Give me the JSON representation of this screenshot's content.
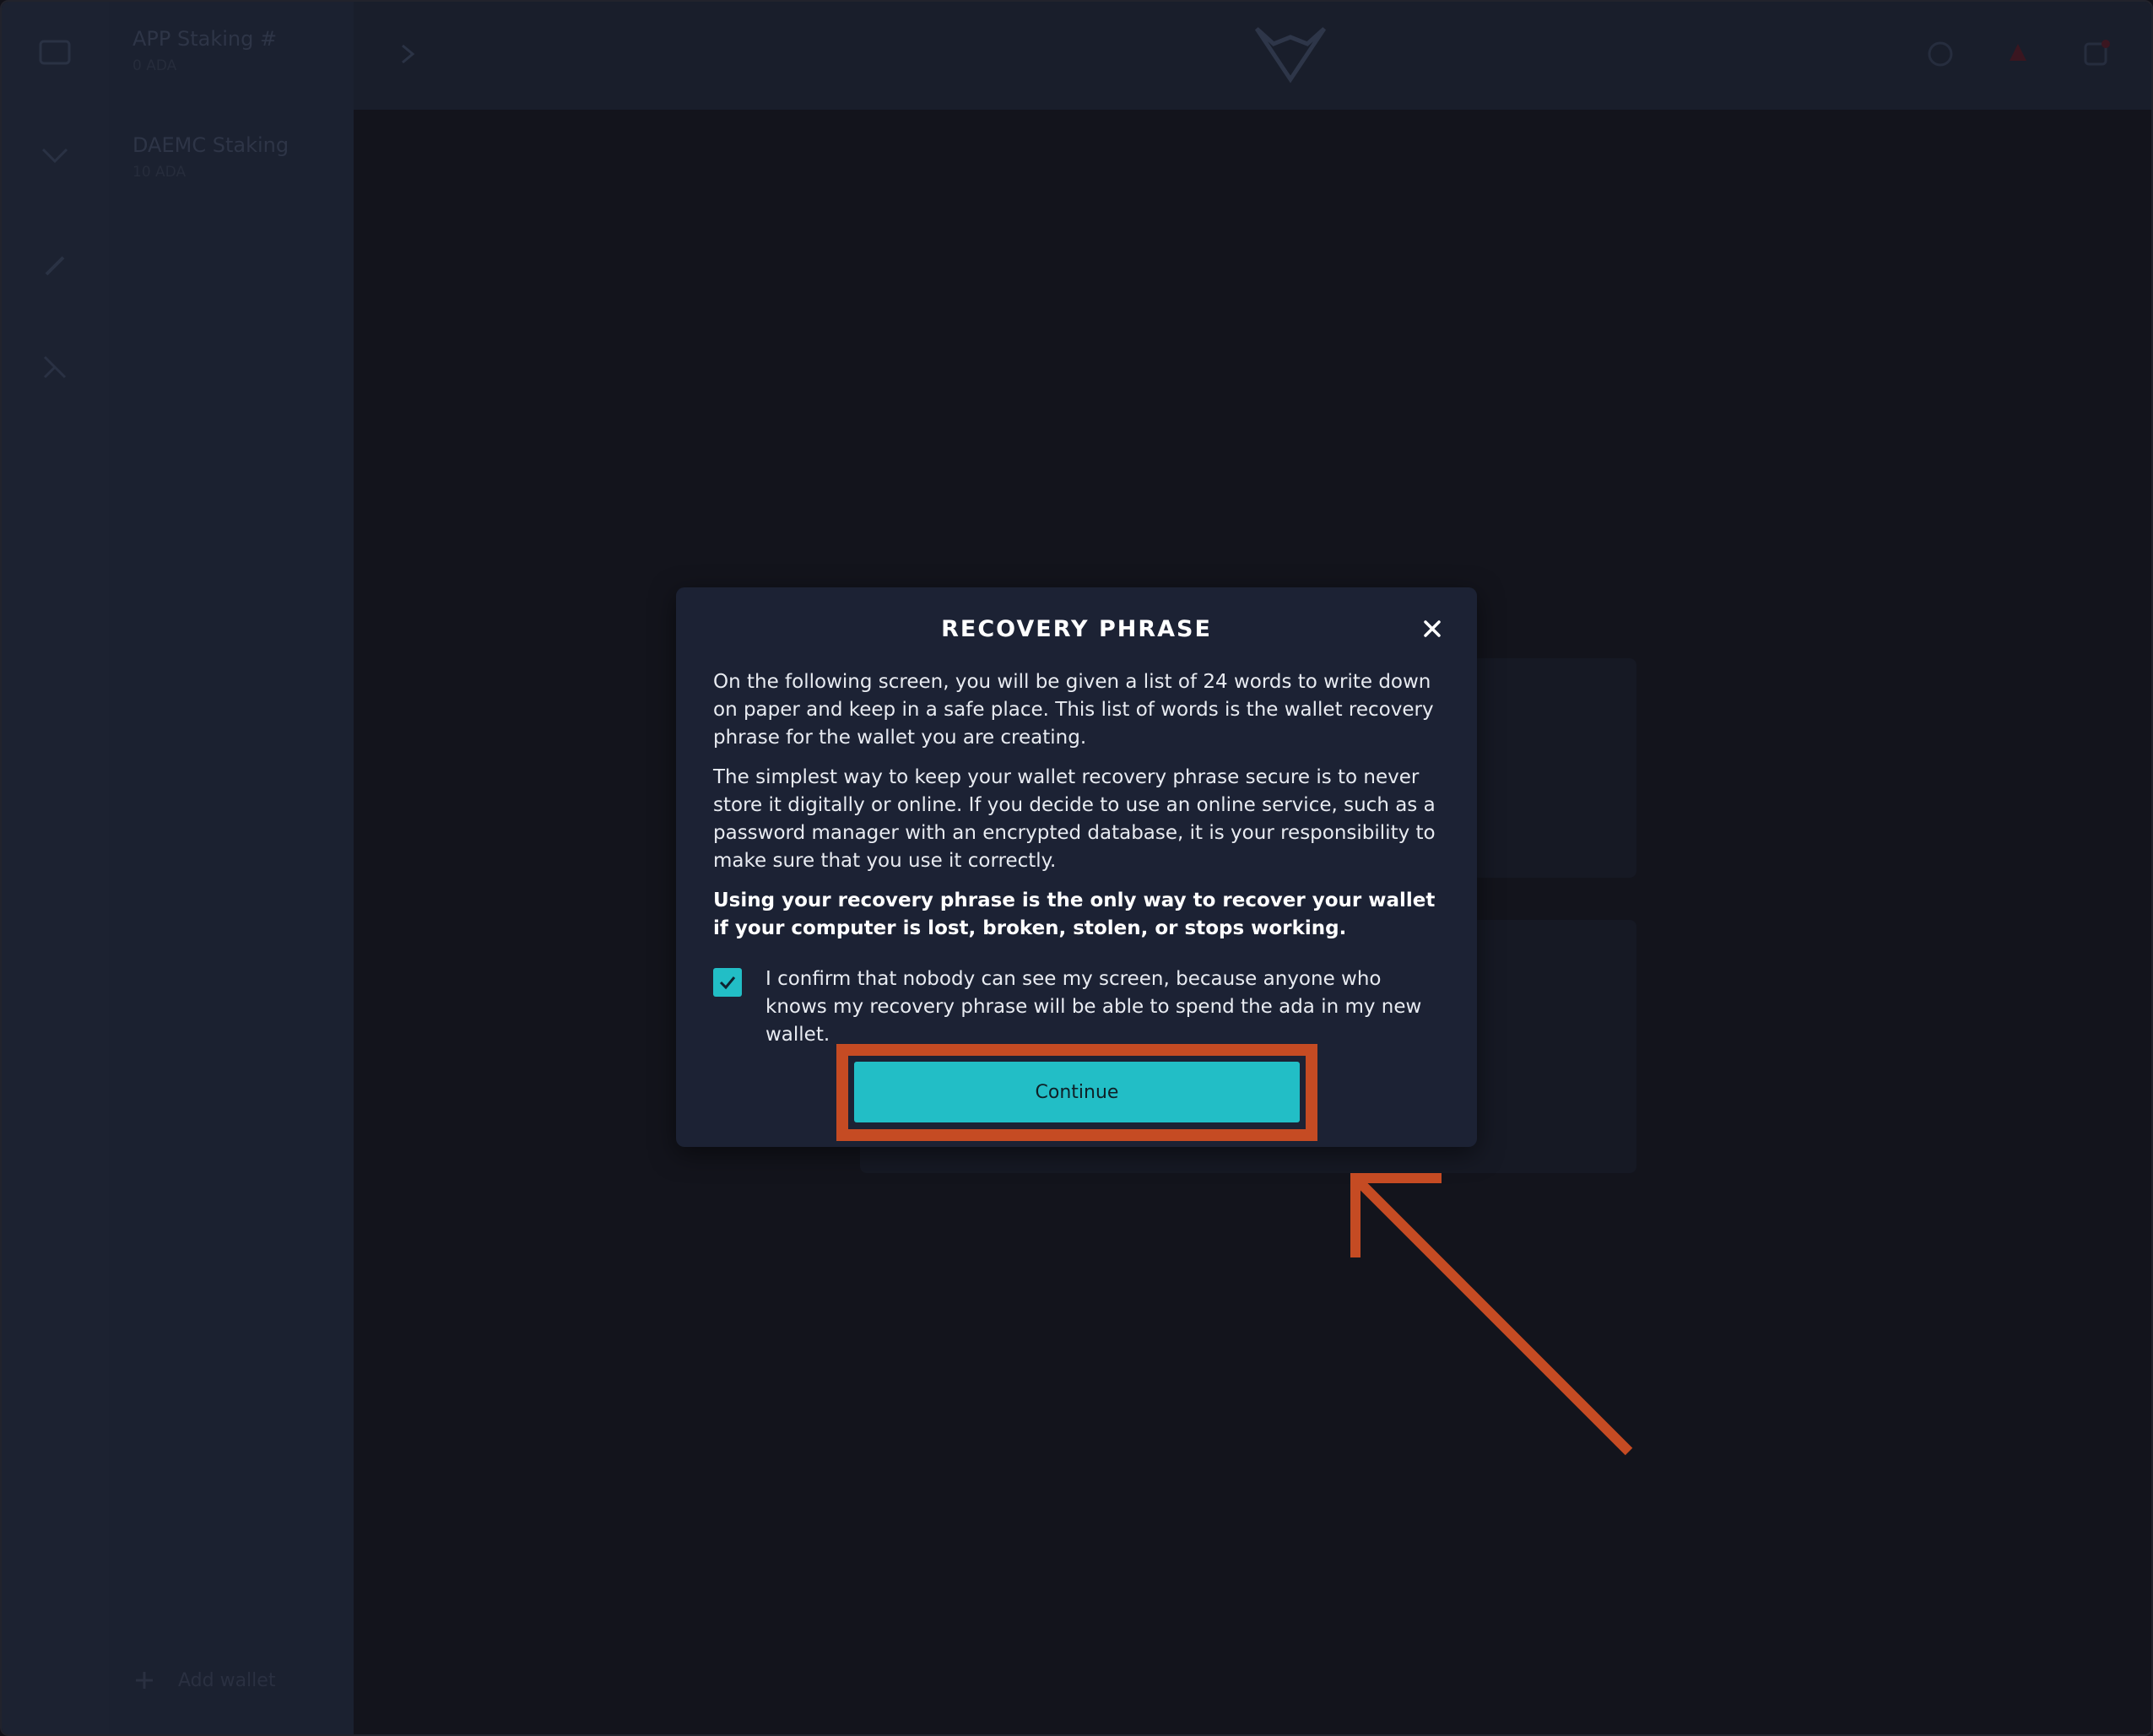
{
  "background": {
    "wallets": [
      {
        "name": "APP Staking #",
        "sub": "0 ADA"
      },
      {
        "name": "DAEMC Staking",
        "sub": "10 ADA"
      }
    ],
    "add_wallet_label": "Add wallet"
  },
  "modal": {
    "title": "RECOVERY PHRASE",
    "paragraphs": [
      "On the following screen, you will be given a list of 24 words to write down on paper and keep in a safe place. This list of words is the wallet recovery phrase for the wallet you are creating.",
      "The simplest way to keep your wallet recovery phrase secure is to never store it digitally or online. If you decide to use an online service, such as a password manager with an encrypted database, it is your responsibility to make sure that you use it correctly."
    ],
    "warning": "Using your recovery phrase is the only way to recover your wallet if your computer is lost, broken, stolen, or stops working.",
    "confirm_label": "I confirm that nobody can see my screen, because anyone who knows my recovery phrase will be able to spend the ada in my new wallet.",
    "confirm_checked": true,
    "continue_label": "Continue"
  },
  "colors": {
    "accent": "#22bec6",
    "annotation": "#c54b23",
    "modal_bg": "#1c2234"
  },
  "icons": [
    "close-icon",
    "checkmark-icon",
    "annotation-arrow"
  ]
}
